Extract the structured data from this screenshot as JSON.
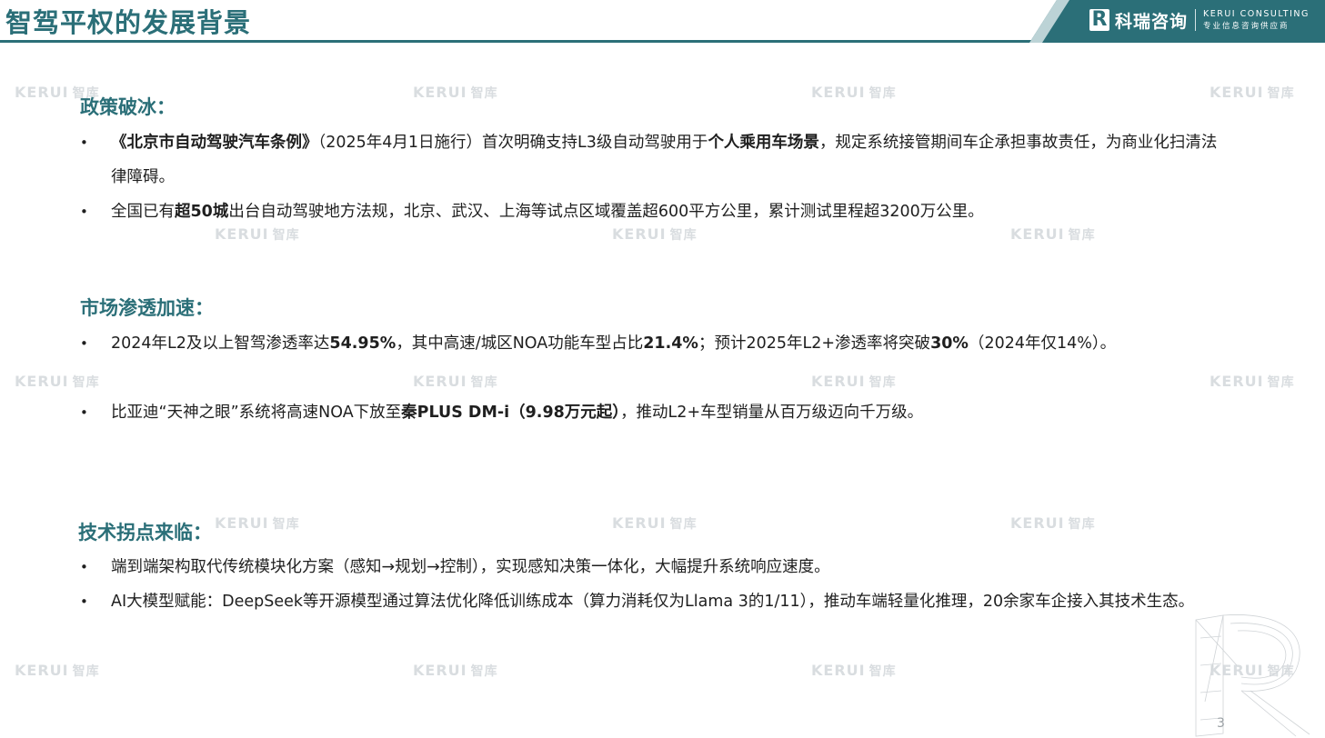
{
  "header": {
    "title": "智驾平权的发展背景",
    "logo_mark": "R",
    "logo_cn": "科瑞咨询",
    "logo_en_top": "KERUI CONSULTING",
    "logo_en_bottom": "专业信息咨询供应商"
  },
  "watermark": {
    "en": "KERUI",
    "cn": "智库"
  },
  "sections": [
    {
      "title": "政策破冰：",
      "bullets": [
        {
          "segments": [
            {
              "text": "《北京市自动驾驶汽车条例》",
              "bold": true
            },
            {
              "text": "（2025年4月1日施行）首次明确支持L3级自动驾驶用于",
              "bold": false
            },
            {
              "text": "个人乘用车场景",
              "bold": true
            },
            {
              "text": "，规定系统接管期间车企承担事故责任，为商业化扫清法律障碍。",
              "bold": false
            }
          ]
        },
        {
          "segments": [
            {
              "text": "全国已有",
              "bold": false
            },
            {
              "text": "超50城",
              "bold": true
            },
            {
              "text": "出台自动驾驶地方法规，北京、武汉、上海等试点区域覆盖超600平方公里，累计测试里程超3200万公里。",
              "bold": false
            }
          ]
        }
      ]
    },
    {
      "title": "市场渗透加速：",
      "bullets": [
        {
          "segments": [
            {
              "text": "2024年L2及以上智驾渗透率达",
              "bold": false
            },
            {
              "text": "54.95%",
              "bold": true
            },
            {
              "text": "，其中高速/城区NOA功能车型占比",
              "bold": false
            },
            {
              "text": "21.4%",
              "bold": true
            },
            {
              "text": "；预计2025年L2+渗透率将突破",
              "bold": false
            },
            {
              "text": "30%",
              "bold": true
            },
            {
              "text": "（2024年仅14%）。",
              "bold": false
            }
          ]
        },
        {
          "segments": [
            {
              "text": "比亚迪“天神之眼”系统将高速NOA下放至",
              "bold": false
            },
            {
              "text": "秦PLUS DM-i（9.98万元起）",
              "bold": true
            },
            {
              "text": "，推动L2+车型销量从百万级迈向千万级。",
              "bold": false
            }
          ]
        }
      ]
    },
    {
      "title": "技术拐点来临：",
      "bullets": [
        {
          "segments": [
            {
              "text": "端到端架构取代传统模块化方案（感知→规划→控制），实现感知决策一体化，大幅提升系统响应速度。",
              "bold": false
            }
          ]
        },
        {
          "segments": [
            {
              "text": "AI大模型赋能：DeepSeek等开源模型通过算法优化降低训练成本（算力消耗仅为Llama 3的1/11），推动车端轻量化推理，20余家车企接入其技术生态。",
              "bold": false
            }
          ]
        }
      ]
    }
  ],
  "page_number": "3",
  "bullet_symbol": "•",
  "colors": {
    "accent": "#2b6f78",
    "text": "#1f1f1f",
    "watermark": "#d9dde0"
  },
  "icons": [
    "logo-r-icon",
    "decorative-wireframe-r"
  ]
}
